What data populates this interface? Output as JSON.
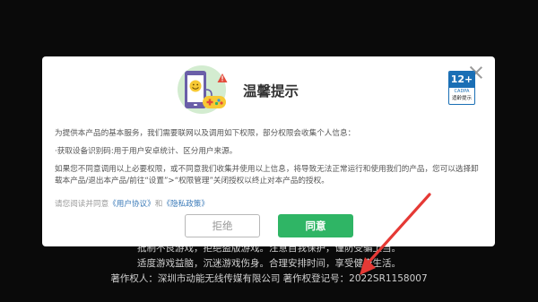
{
  "dialog": {
    "title": "温馨提示",
    "paragraph1": "为提供本产品的基本服务，我们需要联网以及调用如下权限，部分权限会收集个人信息：",
    "paragraph2": "·获取设备识别码:用于用户安卓统计、区分用户来源。",
    "paragraph3": "如果您不同意调用以上必要权限，或不同意我们收集并使用以上信息，将导致无法正常运行和使用我们的产品，您可以选择卸载本产品/退出本产品/前往“设置”>“权限管理”关闭授权以终止对本产品的授权。",
    "agree_prefix": "请您阅读并同意",
    "user_agreement_link": "《用户协议》",
    "and_text": "和",
    "privacy_policy_link": "《隐私政策》",
    "reject_label": "拒绝",
    "accept_label": "同意",
    "age_rating": "12+",
    "age_rating_sub": "CADPA",
    "age_rating_note": "适龄提示",
    "close_icon": "close-icon",
    "hero_icon": "phone-gamepad-icon"
  },
  "footer": {
    "line1": "抵制不良游戏，拒绝盗版游戏。注意自我保护，谨防受骗上当。",
    "line2": "适度游戏益脑，沉迷游戏伤身。合理安排时间，享受健康生活。",
    "line3": "著作权人：深圳市动能无线传媒有限公司    著作权登记号：2022SR1158007"
  },
  "colors": {
    "accent_green": "#2fb565",
    "annotation_red": "#e53935",
    "link_blue": "#3a7ab8",
    "age_badge_blue": "#1a6fb5"
  }
}
